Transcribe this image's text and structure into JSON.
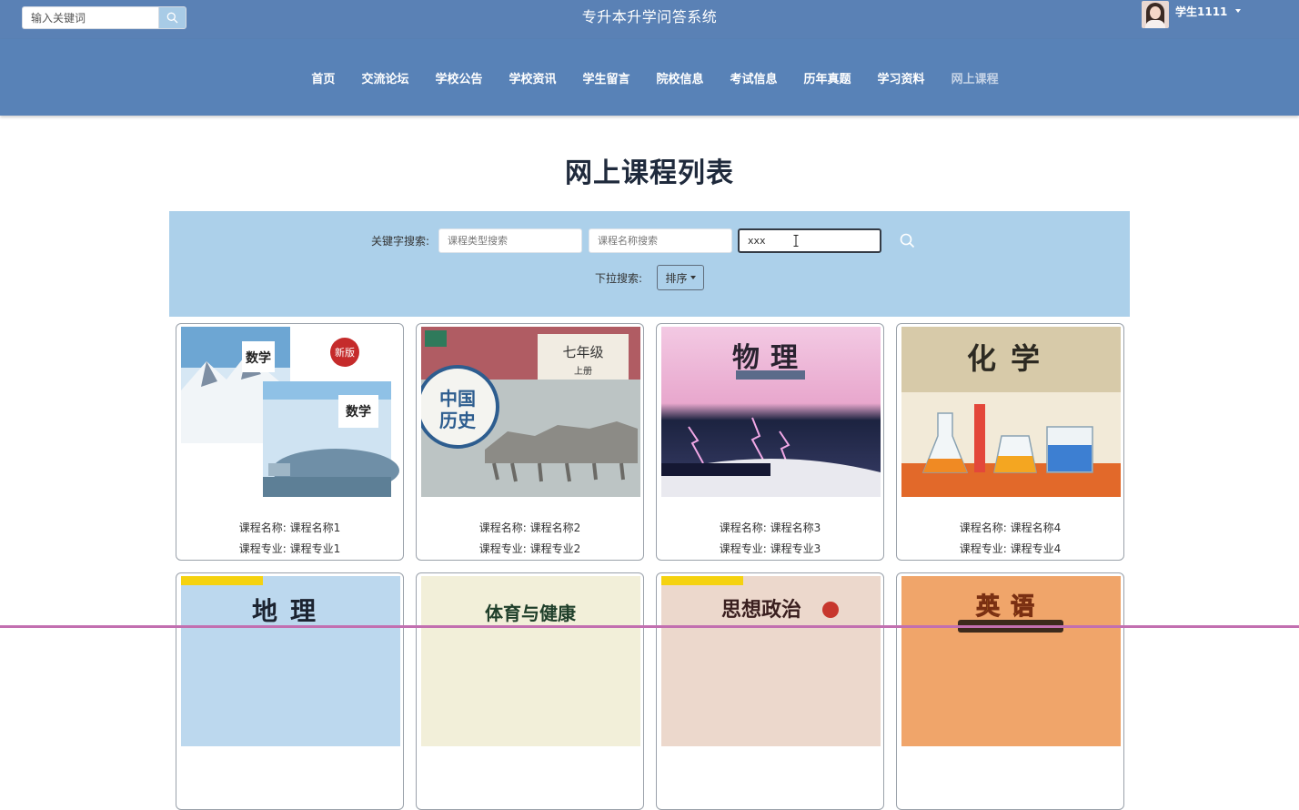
{
  "header": {
    "search_placeholder": "输入关键词",
    "app_title": "专升本升学问答系统",
    "username": "学生1111"
  },
  "nav": {
    "items": [
      "首页",
      "交流论坛",
      "学校公告",
      "学校资讯",
      "学生留言",
      "院校信息",
      "考试信息",
      "历年真题",
      "学习资料",
      "网上课程"
    ],
    "active_index": 9
  },
  "page": {
    "title": "网上课程列表"
  },
  "filter": {
    "keyword_label": "关键字搜索:",
    "type_placeholder": "课程类型搜索",
    "name_placeholder": "课程名称搜索",
    "third_value": "xxx",
    "dropdown_label": "下拉搜索:",
    "sort_label": "排序"
  },
  "courses": [
    {
      "name_line": "课程名称: 课程名称1",
      "major_line": "课程专业: 课程专业1",
      "cover": "数学"
    },
    {
      "name_line": "课程名称: 课程名称2",
      "major_line": "课程专业: 课程专业2",
      "cover": "中国历史"
    },
    {
      "name_line": "课程名称: 课程名称3",
      "major_line": "课程专业: 课程专业3",
      "cover": "物理"
    },
    {
      "name_line": "课程名称: 课程名称4",
      "major_line": "课程专业: 课程专业4",
      "cover": "化学"
    },
    {
      "cover": "地理"
    },
    {
      "cover": "体育与健康"
    },
    {
      "cover": "思想政治"
    },
    {
      "cover": "英语"
    }
  ],
  "colors": {
    "topbar": "#5a81b5",
    "nav": "#5882b7",
    "panel": "#acd0ea",
    "active_nav": "#c5d3e6"
  }
}
